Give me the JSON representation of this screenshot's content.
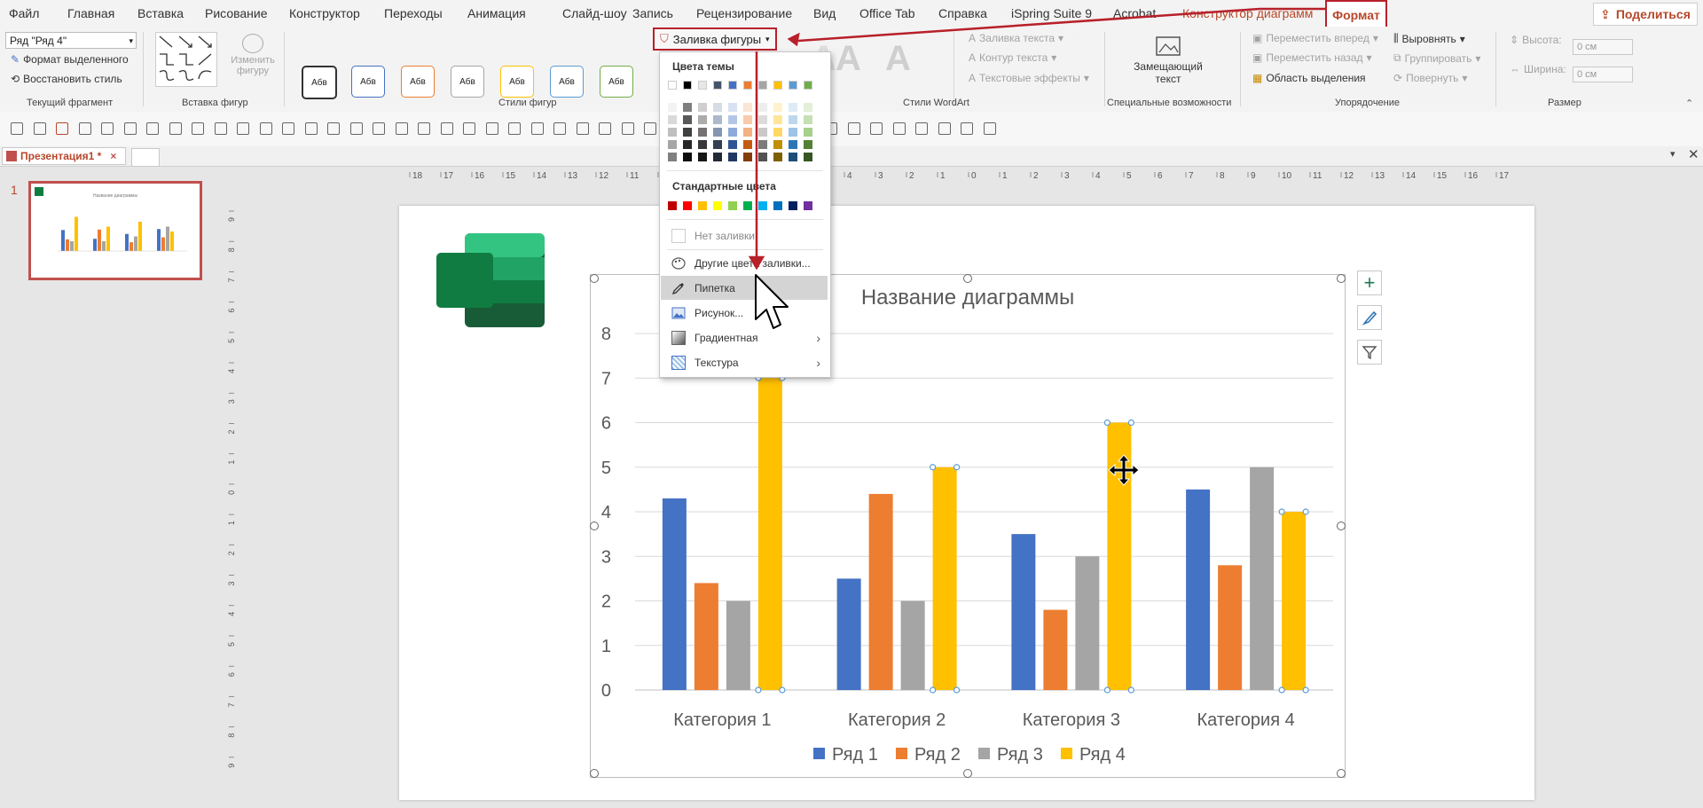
{
  "menu": {
    "items": [
      "Файл",
      "Главная",
      "Вставка",
      "Рисование",
      "Конструктор",
      "Переходы",
      "Анимация",
      "Слайд-шоу",
      "Запись",
      "Рецензирование",
      "Вид",
      "Office Tab",
      "Справка",
      "iSpring Suite 9",
      "Acrobat",
      "Конструктор диаграмм",
      "Формат"
    ],
    "active": "Формат",
    "share": "Поделиться"
  },
  "ribbon": {
    "current_selection": {
      "dropdown_value": "Ряд \"Ряд 4\"",
      "format_selection": "Формат выделенного",
      "reset_style": "Восстановить стиль",
      "label": "Текущий фрагмент"
    },
    "insert_shapes": {
      "edit_shape": "Изменить фигуру",
      "label": "Вставка фигур"
    },
    "shape_styles": {
      "samples": [
        "Абв",
        "Абв",
        "Абв",
        "Абв",
        "Абв",
        "Абв",
        "Абв"
      ],
      "sample_colors": [
        "#333333",
        "#4472c4",
        "#ed7d31",
        "#a5a5a5",
        "#ffc000",
        "#5b9bd5",
        "#70ad47"
      ],
      "label": "Стили фигур"
    },
    "wordart": {
      "fill": "Заливка текста",
      "outline": "Контур текста",
      "effects": "Текстовые эффекты",
      "label": "Стили WordArt",
      "letter": "A"
    },
    "accessibility": {
      "alt_text": "Замещающий текст",
      "label": "Специальные возможности"
    },
    "arrange": {
      "forward": "Переместить вперед",
      "backward": "Переместить назад",
      "selection_pane": "Область выделения",
      "align": "Выровнять",
      "group": "Группировать",
      "rotate": "Повернуть",
      "label": "Упорядочение"
    },
    "size": {
      "height_label": "Высота:",
      "width_label": "Ширина:",
      "height_value": "0 см",
      "width_value": "0 см",
      "label": "Размер"
    }
  },
  "shape_fill_button": "Заливка фигуры",
  "document_tab": "Презентация1 *",
  "slide_number": "1",
  "dropdown": {
    "theme_colors_heading": "Цвета темы",
    "theme_top_row": [
      "#ffffff",
      "#000000",
      "#e7e6e6",
      "#44546a",
      "#4472c4",
      "#ed7d31",
      "#a5a5a5",
      "#ffc000",
      "#5b9bd5",
      "#70ad47"
    ],
    "theme_shades": [
      [
        "#f2f2f2",
        "#d9d9d9",
        "#bfbfbf",
        "#a6a6a6",
        "#808080"
      ],
      [
        "#7f7f7f",
        "#595959",
        "#404040",
        "#262626",
        "#0d0d0d"
      ],
      [
        "#d0cece",
        "#aeabab",
        "#757171",
        "#3a3838",
        "#171616"
      ],
      [
        "#d6dce4",
        "#adb9ca",
        "#8496b0",
        "#333f4f",
        "#222a35"
      ],
      [
        "#d9e2f3",
        "#b4c6e7",
        "#8eaadb",
        "#2f5496",
        "#1f3864"
      ],
      [
        "#fbe5d5",
        "#f7cbac",
        "#f4b183",
        "#c55a11",
        "#843c0b"
      ],
      [
        "#ededed",
        "#dbdbdb",
        "#c9c9c9",
        "#7b7b7b",
        "#525252"
      ],
      [
        "#fff2cc",
        "#fee599",
        "#ffd965",
        "#bf8f00",
        "#7f6000"
      ],
      [
        "#deebf6",
        "#bdd7ee",
        "#9dc3e6",
        "#2e75b5",
        "#1f4e79"
      ],
      [
        "#e2efd9",
        "#c5e0b3",
        "#a8d08d",
        "#538135",
        "#375623"
      ]
    ],
    "standard_colors_heading": "Стандартные цвета",
    "standard_colors": [
      "#c00000",
      "#ff0000",
      "#ffc000",
      "#ffff00",
      "#92d050",
      "#00b050",
      "#00b0f0",
      "#0070c0",
      "#002060",
      "#7030a0"
    ],
    "no_fill": "Нет заливки",
    "more_colors": "Другие цвета заливки...",
    "eyedropper": "Пипетка",
    "picture": "Рисунок...",
    "gradient": "Градиентная",
    "texture": "Текстура"
  },
  "chart_data": {
    "type": "bar",
    "title": "Название диаграммы",
    "categories": [
      "Категория 1",
      "Категория 2",
      "Категория 3",
      "Категория 4"
    ],
    "series": [
      {
        "name": "Ряд 1",
        "color": "#4472c4",
        "values": [
          4.3,
          2.5,
          3.5,
          4.5
        ]
      },
      {
        "name": "Ряд 2",
        "color": "#ed7d31",
        "values": [
          2.4,
          4.4,
          1.8,
          2.8
        ]
      },
      {
        "name": "Ряд 3",
        "color": "#a5a5a5",
        "values": [
          2,
          2,
          3,
          5
        ]
      },
      {
        "name": "Ряд 4",
        "color": "#ffc000",
        "values": [
          7,
          5,
          6,
          4
        ]
      }
    ],
    "ylim": [
      0,
      8
    ],
    "yticks": [
      "0",
      "1",
      "2",
      "3",
      "4",
      "5",
      "6",
      "7",
      "8"
    ],
    "grid": true,
    "legend": "bottom",
    "selected_series": "Ряд 4"
  },
  "thumb_title": "Название диаграммы",
  "accent": "#b7472a",
  "annotation_color": "#b8202a"
}
